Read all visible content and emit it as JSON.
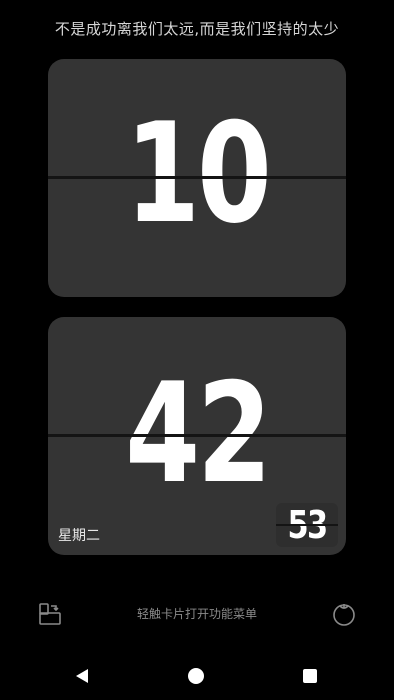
{
  "quote": "不是成功离我们太远,而是我们坚持的太少",
  "clock": {
    "hours": "10",
    "minutes": "42",
    "seconds": "53",
    "weekday": "星期二"
  },
  "bottom_bar": {
    "menu_text": "轻触卡片打开功能菜单",
    "left_icon": "rotate-screen-icon",
    "right_icon": "tomato-icon"
  },
  "nav": {
    "back_icon": "back-triangle-icon",
    "home_icon": "home-circle-icon",
    "recent_icon": "recent-square-icon"
  },
  "colors": {
    "background": "#000000",
    "card": "#343434",
    "digit": "#ffffff",
    "muted_text": "#8a8a8a"
  }
}
